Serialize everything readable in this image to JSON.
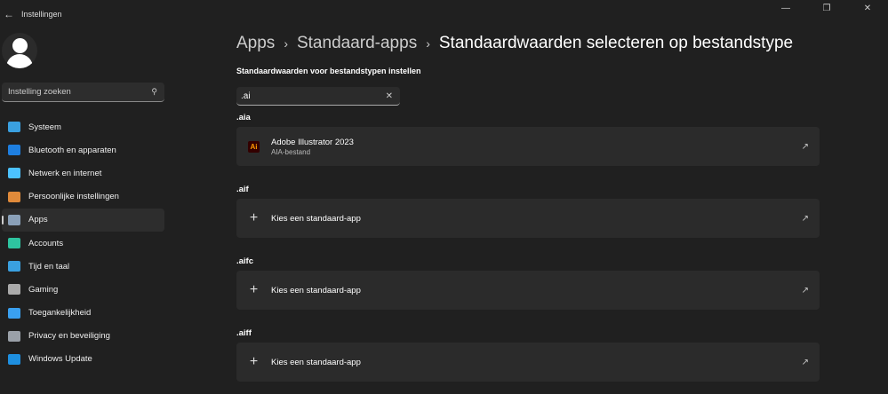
{
  "window": {
    "title": "Instellingen",
    "minimize": "—",
    "maximize": "❐",
    "close": "✕"
  },
  "search": {
    "placeholder": "Instelling zoeken"
  },
  "nav": [
    {
      "label": "Systeem",
      "color": "#3aa0e0"
    },
    {
      "label": "Bluetooth en apparaten",
      "color": "#1e7fe0"
    },
    {
      "label": "Netwerk en internet",
      "color": "#4cc2ff"
    },
    {
      "label": "Persoonlijke instellingen",
      "color": "#e08a3a"
    },
    {
      "label": "Apps",
      "color": "#8aa0b8"
    },
    {
      "label": "Accounts",
      "color": "#2ec4a0"
    },
    {
      "label": "Tijd en taal",
      "color": "#3aa0e0"
    },
    {
      "label": "Gaming",
      "color": "#aaaaaa"
    },
    {
      "label": "Toegankelijkheid",
      "color": "#3aa0f0"
    },
    {
      "label": "Privacy en beveiliging",
      "color": "#9aa0a8"
    },
    {
      "label": "Windows Update",
      "color": "#1e8fe0"
    }
  ],
  "breadcrumb": [
    "Apps",
    "Standaard-apps",
    "Standaardwaarden selecteren op bestandstype"
  ],
  "subtitle": "Standaardwaarden voor bestandstypen instellen",
  "filter": {
    "value": ".ai"
  },
  "groups": [
    {
      "ext": ".aia",
      "app": "Adobe Illustrator 2023",
      "desc": "AIA-bestand",
      "icon": "Ai"
    },
    {
      "ext": ".aif",
      "app": "Kies een standaard-app"
    },
    {
      "ext": ".aifc",
      "app": "Kies een standaard-app"
    },
    {
      "ext": ".aiff",
      "app": "Kies een standaard-app"
    }
  ]
}
